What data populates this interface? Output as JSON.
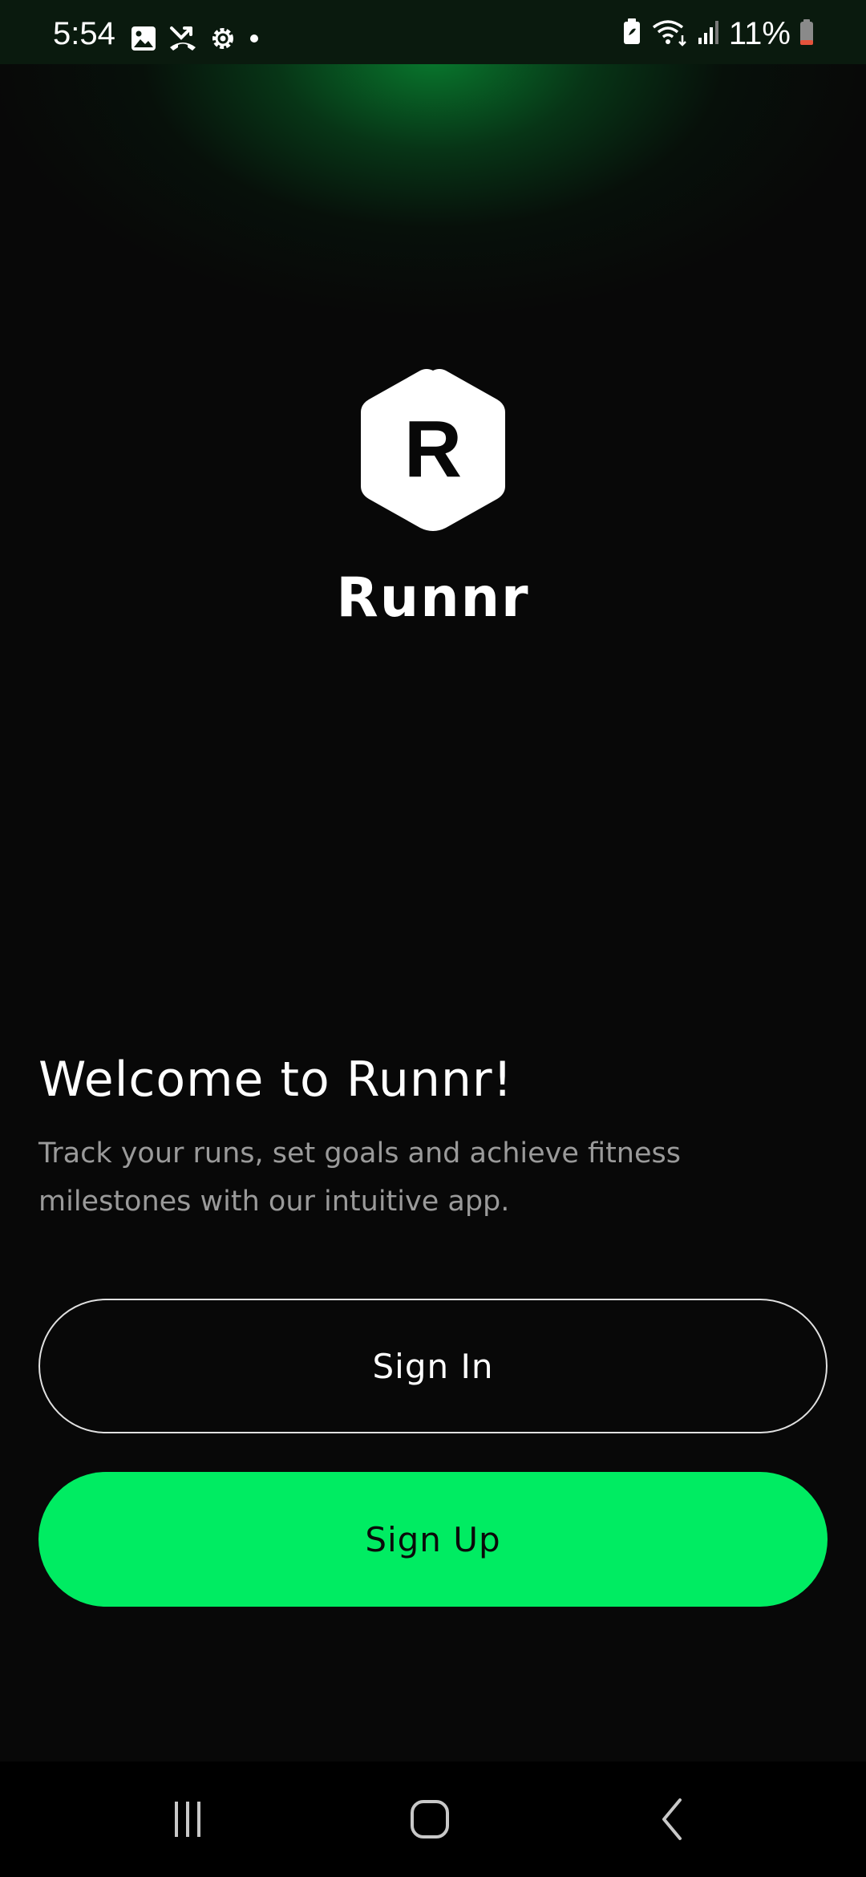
{
  "status_bar": {
    "time": "5:54",
    "left_icons": [
      "image-icon",
      "missed-call-icon",
      "settings-gear-icon",
      "notification-dot-icon"
    ],
    "right_icons": [
      "battery-saver-icon",
      "wifi-icon",
      "signal-icon"
    ],
    "battery_percent": "11%"
  },
  "logo": {
    "letter": "R",
    "shape": "hexagon"
  },
  "app": {
    "name": "Runnr"
  },
  "welcome": {
    "title": "Welcome to Runnr!",
    "description": "Track your runs, set goals and achieve fitness milestones with our intuitive app."
  },
  "buttons": {
    "sign_in_label": "Sign In",
    "sign_up_label": "Sign Up"
  },
  "nav_bar": {
    "items": [
      "recents-icon",
      "home-icon",
      "back-icon"
    ]
  },
  "colors": {
    "background": "#080808",
    "accent": "#00EC62",
    "glow": "#088C34",
    "text_primary": "#FFFFFF",
    "text_secondary": "#9A9A9A"
  }
}
